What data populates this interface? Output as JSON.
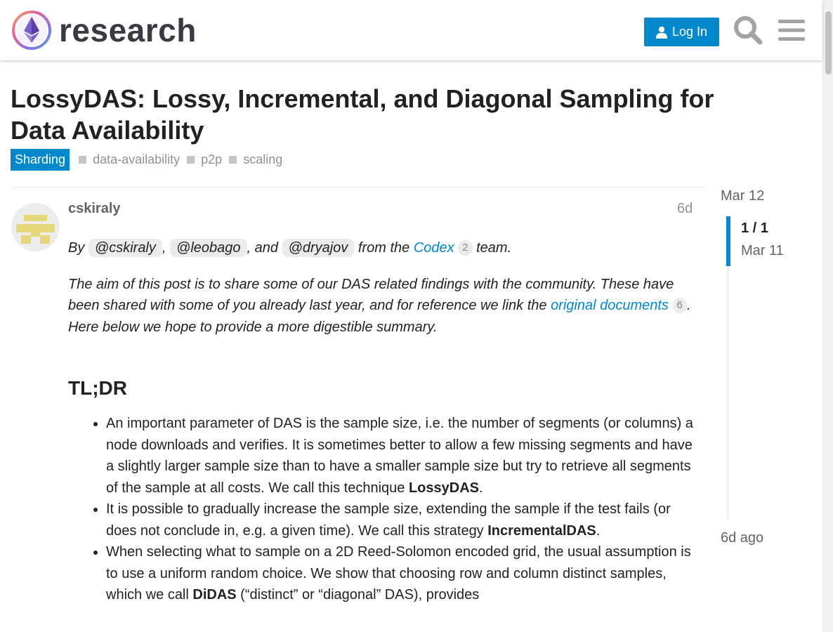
{
  "header": {
    "logo_text": "research",
    "login_label": "Log In"
  },
  "topic": {
    "title": "LossyDAS: Lossy, Incremental, and Diagonal Sampling for Data Availability",
    "category": "Sharding",
    "category_color": "#0088cc",
    "tags": [
      "data-availability",
      "p2p",
      "scaling"
    ]
  },
  "post": {
    "username": "cskiraly",
    "date": "6d",
    "intro": {
      "by": "By",
      "mention1": "@cskiraly",
      "sep1": ",",
      "mention2": "@leobago",
      "sep2": ", and",
      "mention3": "@dryajov",
      "from": "from the",
      "codex": "Codex",
      "codex_count": "2",
      "team": "team."
    },
    "aim": {
      "text1": "The aim of this post is to share some of our DAS related findings with the community. These have been shared with some of you already last year, and for reference we link the",
      "link": "original documents",
      "link_count": "6",
      "text2": ". Here below we hope to provide a more digestible summary."
    },
    "heading": "TL;DR",
    "bullets": [
      {
        "text": "An important parameter of DAS is the sample size, i.e. the number of segments (or columns) a node downloads and verifies. It is sometimes better to allow a few missing segments and have a slightly larger sample size than to have a smaller sample size but try to retrieve all segments of the sample at all costs. We call this technique",
        "bold": "LossyDAS",
        "end": "."
      },
      {
        "text": "It is possible to gradually increase the sample size, extending the sample if the test fails (or does not conclude in, e.g. a given time). We call this strategy",
        "bold": "IncrementalDAS",
        "end": "."
      },
      {
        "text": "When selecting what to sample on a 2D Reed-Solomon encoded grid, the usual assumption is to use a uniform random choice. We show that choosing row and column distinct samples, which we call",
        "bold": "DiDAS",
        "end": " (“distinct” or “diagonal” DAS), provides"
      }
    ]
  },
  "timeline": {
    "top_date": "Mar 12",
    "position": "1 / 1",
    "position_date": "Mar 11",
    "bottom": "6d ago"
  },
  "icons": {
    "logo": "ethereum-research-logo",
    "login": "user-icon",
    "search": "search-icon",
    "menu": "hamburger-menu-icon"
  }
}
